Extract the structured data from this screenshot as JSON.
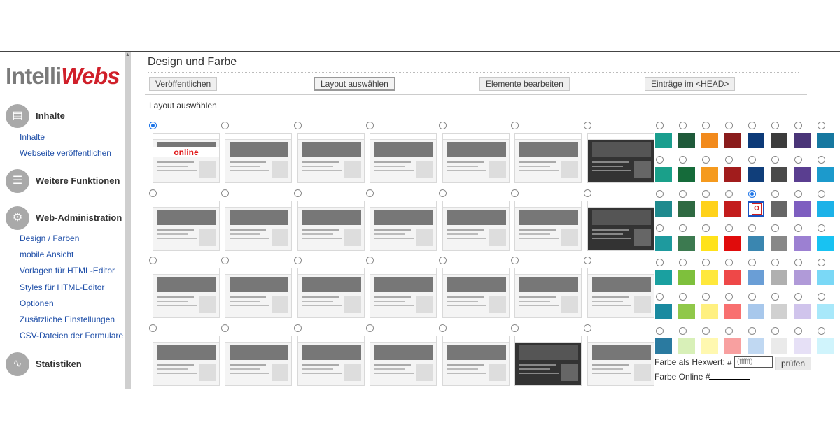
{
  "sidebar": {
    "logo_part1": "Intelli",
    "logo_part2": "Webs",
    "sections": {
      "inhalte": "Inhalte",
      "weitere": "Weitere Funktionen",
      "webadmin": "Web-Administration",
      "statistiken": "Statistiken"
    },
    "inhalte_links": [
      "Inhalte",
      "Webseite veröffentlichen"
    ],
    "webadmin_links": [
      "Design / Farben",
      "mobile Ansicht",
      "Vorlagen für HTML-Editor",
      "Styles für HTML-Editor",
      "Optionen",
      "Zusätzliche Einstellungen",
      "CSV-Dateien der Formulare"
    ]
  },
  "header": {
    "title": "Design und Farbe",
    "tabs": [
      "Veröffentlichen",
      "Layout auswählen",
      "Elemente bearbeiten",
      "Einträge im <HEAD>"
    ],
    "active_tab": "Layout auswählen"
  },
  "section_label": "Layout auswählen",
  "layouts": {
    "rows": 4,
    "columns": 7,
    "selected": 0,
    "first_thumbnail_text": "online"
  },
  "color_grid": {
    "rows": [
      [
        "#1a9e8e",
        "#1f5a3a",
        "#f28a1c",
        "#8a1c1c",
        "#0c3a78",
        "#3c3c3c",
        "#4a3578",
        "#1678a0"
      ],
      [
        "#1aa08a",
        "#156b3a",
        "#f59a1e",
        "#a11c1c",
        "#103e7a",
        "#4a4a4a",
        "#5a3e90",
        "#1c9acc"
      ],
      [
        "#1f8a8e",
        "#2f6a42",
        "#ffd21a",
        "#c31c1c",
        "#selected",
        "#666666",
        "#7e5ec0",
        "#1cb2e8"
      ],
      [
        "#1e9a9e",
        "#3c7a50",
        "#ffe21a",
        "#e00c0c",
        "#3a86b0",
        "#888888",
        "#9c80d2",
        "#18c2f2"
      ],
      [
        "#1aa0a0",
        "#7ec03c",
        "#ffe83c",
        "#ee4848",
        "#6a9ed6",
        "#b0b0b0",
        "#b09ad8",
        "#7ad8f6"
      ],
      [
        "#1a8aa0",
        "#90c84a",
        "#fff080",
        "#f87070",
        "#a8c8ec",
        "#d0d0d0",
        "#d0c4ec",
        "#a8e8fa"
      ],
      [
        "#2a7aa0",
        "#d8f0b8",
        "#fff8b0",
        "#f8a0a0",
        "#c0d8f2",
        "#eaeaea",
        "#e6e0f6",
        "#d0f4fc"
      ]
    ],
    "selected_row": 2,
    "selected_col": 4,
    "selected_letter": "O"
  },
  "hex": {
    "label": "Farbe als Hexwert: #",
    "placeholder": "(ffffff)",
    "check_label": "prüfen",
    "online_label": "Farbe Online #"
  }
}
